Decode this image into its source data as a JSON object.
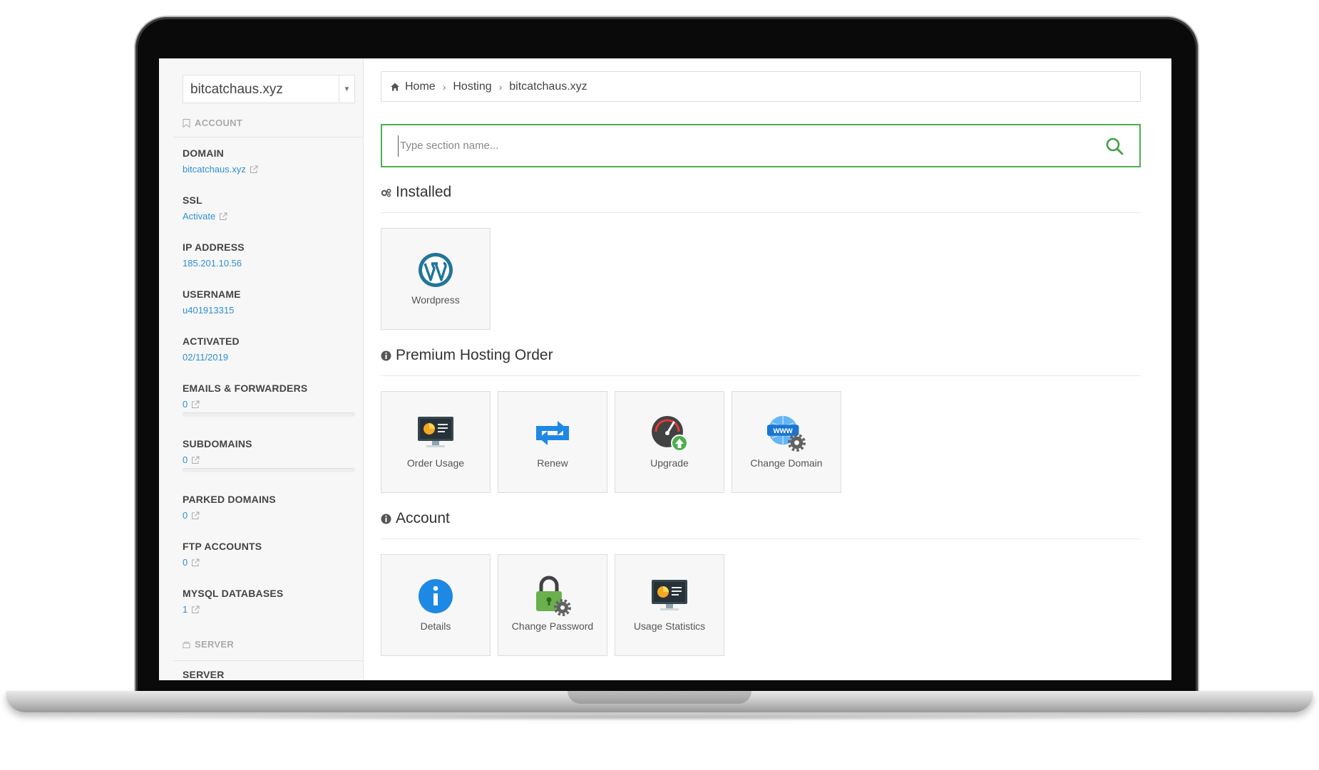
{
  "sidebar": {
    "domain_select": "bitcatchaus.xyz",
    "account_heading": "ACCOUNT",
    "items": [
      {
        "label": "DOMAIN",
        "value": "bitcatchaus.xyz"
      },
      {
        "label": "SSL",
        "value": "Activate"
      },
      {
        "label": "IP ADDRESS",
        "value": "185.201.10.56"
      },
      {
        "label": "USERNAME",
        "value": "u401913315"
      },
      {
        "label": "ACTIVATED",
        "value": "02/11/2019"
      },
      {
        "label": "EMAILS & FORWARDERS",
        "value": "0"
      },
      {
        "label": "SUBDOMAINS",
        "value": "0"
      },
      {
        "label": "PARKED DOMAINS",
        "value": "0"
      },
      {
        "label": "FTP ACCOUNTS",
        "value": "0"
      },
      {
        "label": "MYSQL DATABASES",
        "value": "1"
      }
    ],
    "server_heading": "SERVER",
    "server_label": "SERVER"
  },
  "breadcrumb": {
    "home": "Home",
    "hosting": "Hosting",
    "current": "bitcatchaus.xyz"
  },
  "search": {
    "placeholder": "Type section name..."
  },
  "sections": {
    "installed": {
      "title": "Installed",
      "tiles": [
        {
          "label": "Wordpress",
          "icon": "wordpress-icon"
        }
      ]
    },
    "premium": {
      "title": "Premium Hosting Order",
      "tiles": [
        {
          "label": "Order Usage",
          "icon": "monitor-chart-icon"
        },
        {
          "label": "Renew",
          "icon": "renew-arrows-icon"
        },
        {
          "label": "Upgrade",
          "icon": "speedometer-upgrade-icon"
        },
        {
          "label": "Change Domain",
          "icon": "www-globe-gear-icon"
        }
      ]
    },
    "account": {
      "title": "Account",
      "tiles": [
        {
          "label": "Details",
          "icon": "info-circle-icon"
        },
        {
          "label": "Change Password",
          "icon": "lock-gear-icon"
        },
        {
          "label": "Usage Statistics",
          "icon": "monitor-chart-icon"
        }
      ]
    }
  },
  "colors": {
    "link": "#2e8fd6",
    "search_border": "#4caf50",
    "wordpress": "#21759b",
    "renew": "#1e88e5",
    "upgrade_arrow": "#4caf50",
    "details": "#1e88e5",
    "lock": "#6ab04c"
  }
}
